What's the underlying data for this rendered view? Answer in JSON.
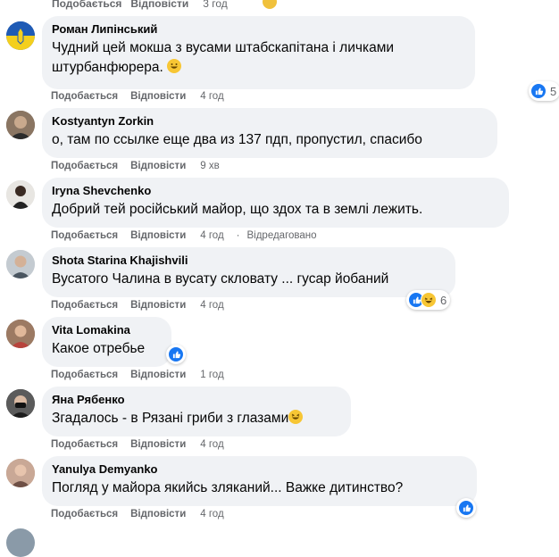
{
  "top": {
    "like": "Подобається",
    "reply": "Відповісти",
    "time": "3 год"
  },
  "comments": [
    {
      "author": "Роман Липінський",
      "text": "Чудний цей мокша з вусами штабскапітана і личками штурбанфюрера.",
      "like": "Подобається",
      "reply": "Відповісти",
      "time": "4 год",
      "reaction_count": "5",
      "reactions": [
        "like-icon"
      ]
    },
    {
      "author": "Kostyantyn Zorkin",
      "text": "о, там по ссылке еще два из 137 пдп, пропустил, спасибо",
      "like": "Подобається",
      "reply": "Відповісти",
      "time": "9 хв"
    },
    {
      "author": "Iryna Shevchenko",
      "text": "Добрий тей російський майор, що здох та в землі лежить.",
      "like": "Подобається",
      "reply": "Відповісти",
      "time": "4 год",
      "edited": "Відредаговано"
    },
    {
      "author": "Shota Starina Khajishvili",
      "text": "Вусатого Чалина в вусату скловату ... гусар йобаний",
      "like": "Подобається",
      "reply": "Відповісти",
      "time": "4 год",
      "reaction_count": "6",
      "reactions": [
        "like-icon",
        "haha-icon"
      ]
    },
    {
      "author": "Vita Lomakina",
      "text": "Какое отребье",
      "like": "Подобається",
      "reply": "Відповісти",
      "time": "1 год",
      "reactions": [
        "like-icon"
      ]
    },
    {
      "author": "Яна Рябенко",
      "text": "Згадалось - в Рязані гриби з глазами",
      "like": "Подобається",
      "reply": "Відповісти",
      "time": "4 год"
    },
    {
      "author": "Yanulya Demyanko",
      "text": "Погляд у майора якийсь зляканий... Важке дитинство?",
      "like": "Подобається",
      "reply": "Відповісти",
      "time": "4 год",
      "reactions": [
        "like-icon"
      ]
    }
  ],
  "colors": {
    "bubble": "#f0f2f5",
    "like_blue": "#1877f2",
    "meta_gray": "#65676b"
  }
}
